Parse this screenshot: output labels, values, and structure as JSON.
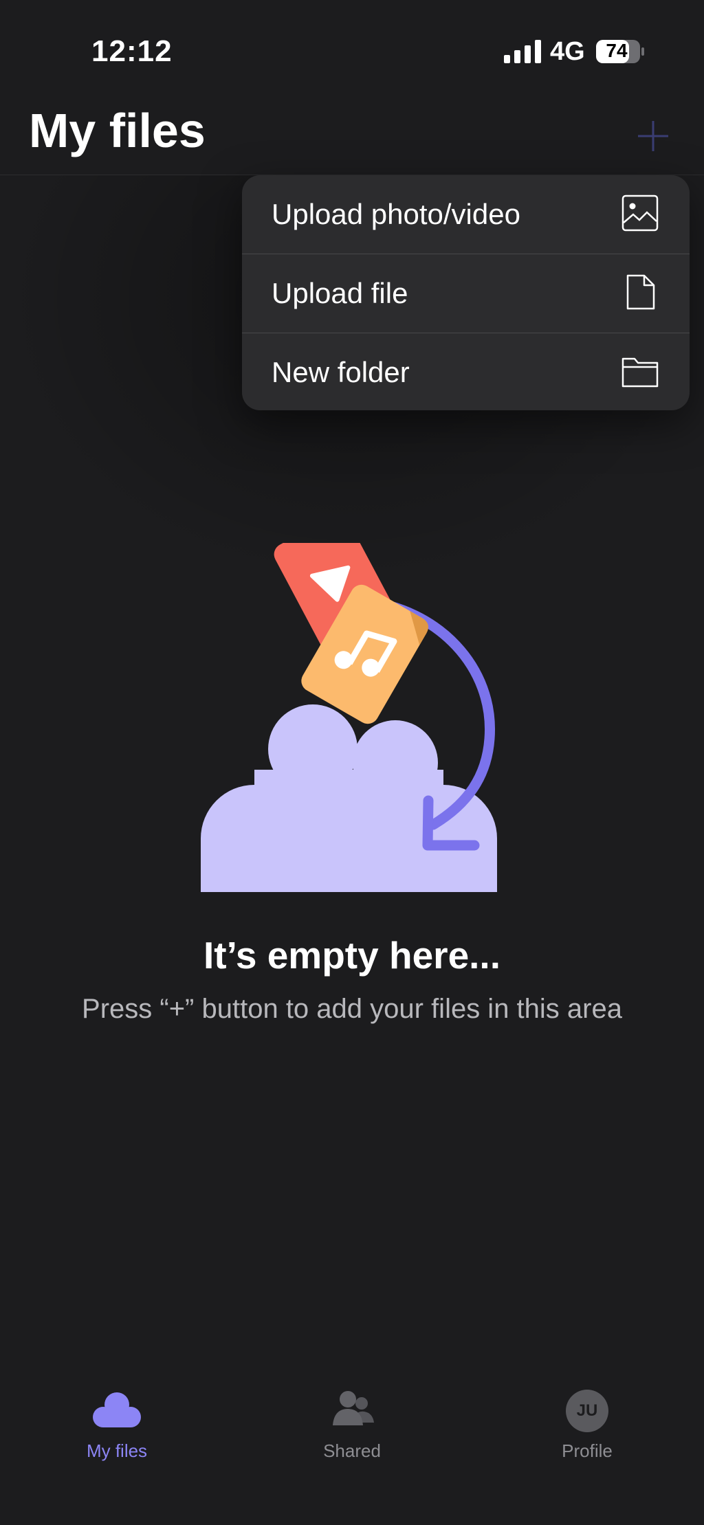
{
  "status_bar": {
    "time": "12:12",
    "network": "4G",
    "battery": "74"
  },
  "header": {
    "title": "My files"
  },
  "menu": {
    "items": [
      {
        "label": "Upload photo/video",
        "icon": "image-icon"
      },
      {
        "label": "Upload file",
        "icon": "file-icon"
      },
      {
        "label": "New folder",
        "icon": "folder-icon"
      }
    ]
  },
  "empty_state": {
    "title": "It’s empty here...",
    "subtitle": "Press “+” button to add your files in this area"
  },
  "tabbar": {
    "tabs": [
      {
        "label": "My files",
        "icon": "cloud-icon",
        "active": true
      },
      {
        "label": "Shared",
        "icon": "people-icon",
        "active": false
      },
      {
        "label": "Profile",
        "icon": "avatar",
        "initials": "JU",
        "active": false
      }
    ]
  },
  "colors": {
    "accent": "#8c85f5",
    "cloud": "#c9c4fb",
    "arrow": "#7b73ec",
    "video_card": "#f6695a",
    "music_card": "#fcba6d",
    "background": "#1c1c1e"
  }
}
